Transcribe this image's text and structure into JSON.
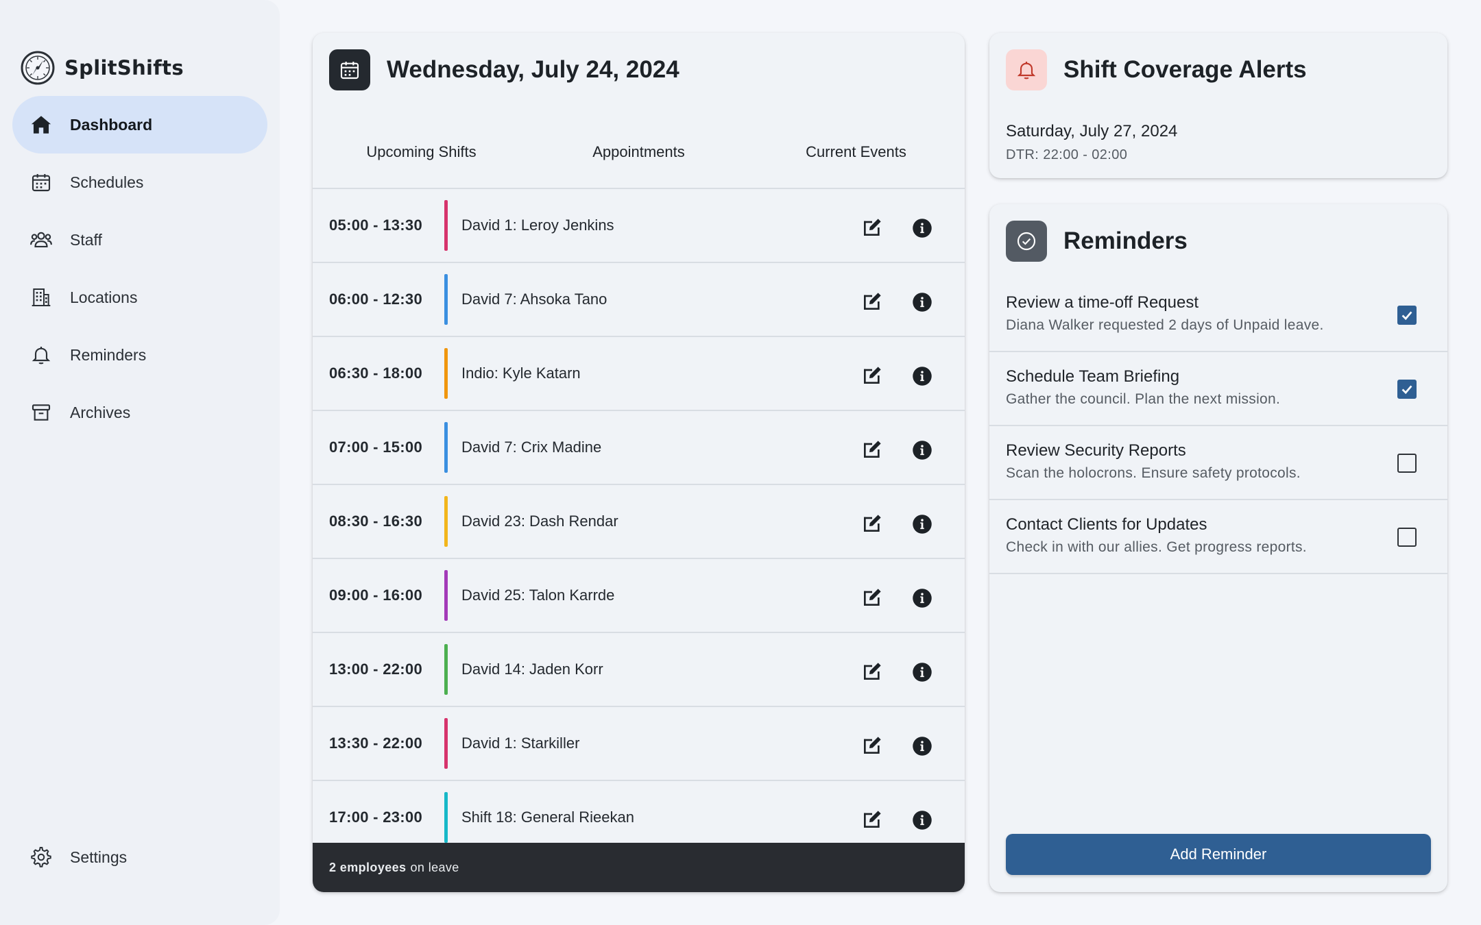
{
  "app": {
    "name": "SplitShifts",
    "logo_icon": "compass-clock-logo"
  },
  "sidebar": {
    "items": [
      {
        "label": "Dashboard",
        "icon": "home-icon",
        "active": true
      },
      {
        "label": "Schedules",
        "icon": "calendar-icon",
        "active": false
      },
      {
        "label": "Staff",
        "icon": "people-icon",
        "active": false
      },
      {
        "label": "Locations",
        "icon": "building-icon",
        "active": false
      },
      {
        "label": "Reminders",
        "icon": "bell-icon",
        "active": false
      },
      {
        "label": "Archives",
        "icon": "archive-icon",
        "active": false
      }
    ],
    "settings": {
      "label": "Settings",
      "icon": "gear-icon"
    }
  },
  "shifts": {
    "date_title": "Wednesday, July 24, 2024",
    "tabs": [
      "Upcoming Shifts",
      "Appointments",
      "Current Events"
    ],
    "rows": [
      {
        "time": "05:00 - 13:30",
        "label": "David 1: Leroy Jenkins",
        "color": "#d6336c"
      },
      {
        "time": "06:00 - 12:30",
        "label": "David 7: Ahsoka Tano",
        "color": "#3b8fe0"
      },
      {
        "time": "06:30 - 18:00",
        "label": "Indio: Kyle Katarn",
        "color": "#f0960e"
      },
      {
        "time": "07:00 - 15:00",
        "label": "David 7: Crix Madine",
        "color": "#3b8fe0"
      },
      {
        "time": "08:30 - 16:30",
        "label": "David 23: Dash Rendar",
        "color": "#f2b51c"
      },
      {
        "time": "09:00 - 16:00",
        "label": "David 25: Talon Karrde",
        "color": "#a33ab8"
      },
      {
        "time": "13:00 - 22:00",
        "label": "David 14: Jaden Korr",
        "color": "#4caf50"
      },
      {
        "time": "13:30 - 22:00",
        "label": "David 1: Starkiller",
        "color": "#d6336c"
      },
      {
        "time": "17:00 - 23:00",
        "label": "Shift 18: General Rieekan",
        "color": "#17b8c8"
      }
    ],
    "partial_row_color": "#17b8c8",
    "footer": {
      "count": "2 employees",
      "suffix": "on leave"
    }
  },
  "alerts": {
    "title": "Shift Coverage Alerts",
    "date": "Saturday, July 27, 2024",
    "detail": "DTR: 22:00 - 02:00"
  },
  "reminders": {
    "title": "Reminders",
    "items": [
      {
        "title": "Review a time-off Request",
        "subtitle": "Diana Walker requested 2 days of Unpaid leave.",
        "checked": true
      },
      {
        "title": "Schedule Team Briefing",
        "subtitle": "Gather the council. Plan the next mission.",
        "checked": true
      },
      {
        "title": "Review Security Reports",
        "subtitle": "Scan the holocrons. Ensure safety protocols.",
        "checked": false
      },
      {
        "title": "Contact Clients for Updates",
        "subtitle": "Check in with our allies. Get progress reports.",
        "checked": false
      }
    ],
    "add_button": "Add Reminder"
  },
  "colors": {
    "accent": "#2f5f93",
    "active_nav": "#d6e3f8",
    "alert_badge": "#fad6d4",
    "footer_bg": "#292c31"
  }
}
